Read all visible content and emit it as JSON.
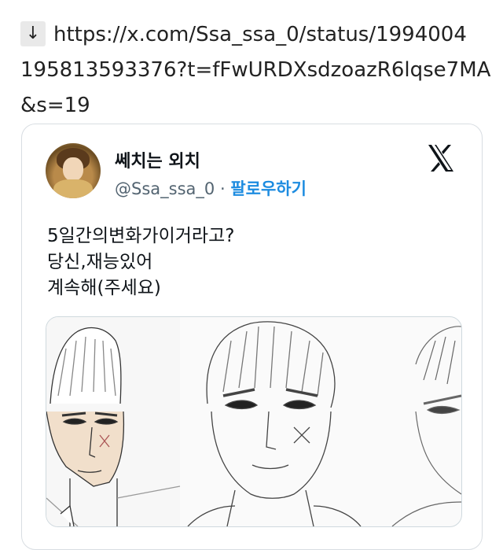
{
  "link": {
    "icon": "down-arrow-icon",
    "arrow_glyph": "↓",
    "url_lines": [
      "https://x.com/Ssa_ssa_0/status/1994004",
      "195813593376?t=fFwURDXsdzoazR6lqse7MA",
      "&s=19"
    ]
  },
  "tweet": {
    "display_name": "쎄치는 외치",
    "handle": "@Ssa_ssa_0",
    "separator": "·",
    "follow_label": "팔로우하기",
    "follow_color": "#1d8ce0",
    "text_lines": [
      "5일간의변화가이거라고?",
      "당신,재능있어",
      "계속해(주세요)"
    ],
    "logo_icon": "x-logo-icon"
  }
}
